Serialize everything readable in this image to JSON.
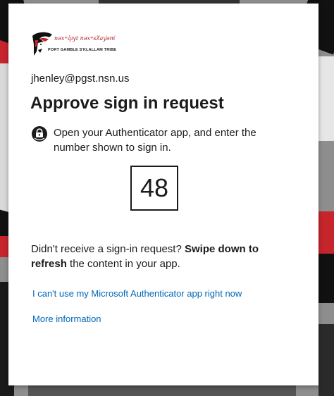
{
  "background": {
    "colors": {
      "base": "#8e8e8e",
      "dark": "#111111",
      "red": "#c6252c",
      "light": "#d9d9d9"
    }
  },
  "brand": {
    "logo_icon": "orca-logo-icon",
    "logo_line1": "nəxʷq̓ıyt nəxʷsƛ̕ay̕əm̕",
    "logo_line2": "PORT GAMBLE S'KLALLAM TRIBE",
    "accent": "#b3202a"
  },
  "signin": {
    "identity": "jhenley@pgst.nsn.us",
    "title": "Approve sign in request",
    "auth_icon": "authenticator-lock-icon",
    "instruction": "Open your Authenticator app, and enter the number shown to sign in.",
    "number": "48",
    "help_prefix": "Didn't receive a sign-in request? ",
    "help_bold": "Swipe down to refresh",
    "help_suffix": " the content in your app.",
    "link_cant_use": "I can't use my Microsoft Authenticator app right now",
    "link_more_info": "More information",
    "link_color": "#0067b8"
  }
}
